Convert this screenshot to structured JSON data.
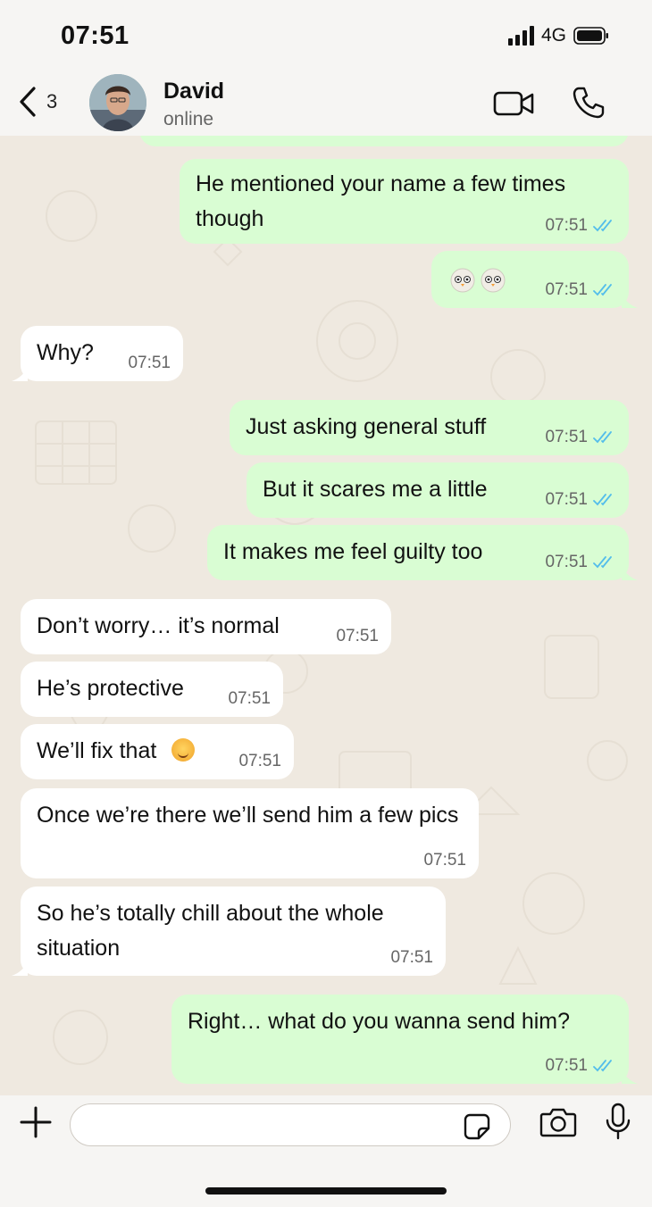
{
  "status_bar": {
    "time": "07:51",
    "network": "4G",
    "icons": [
      "signal-icon",
      "battery-icon"
    ]
  },
  "header": {
    "back_count": "3",
    "contact_name": "David",
    "contact_status": "online",
    "icons": [
      "chevron-left-icon",
      "video-camera-icon",
      "phone-icon"
    ]
  },
  "messages": [
    {
      "direction": "out",
      "text": "He mentioned your name a few times though",
      "time": "07:51",
      "status": "read"
    },
    {
      "direction": "out",
      "text": "",
      "stickers": 2,
      "time": "07:51",
      "status": "read"
    },
    {
      "direction": "in",
      "text": "Why?",
      "time": "07:51"
    },
    {
      "direction": "out",
      "text": "Just asking general stuff",
      "time": "07:51",
      "status": "read"
    },
    {
      "direction": "out",
      "text": "But it scares me a little",
      "time": "07:51",
      "status": "read"
    },
    {
      "direction": "out",
      "text": "It makes me feel guilty too",
      "time": "07:51",
      "status": "read"
    },
    {
      "direction": "in",
      "text": "Don’t worry… it’s normal",
      "time": "07:51"
    },
    {
      "direction": "in",
      "text": "He’s protective",
      "time": "07:51"
    },
    {
      "direction": "in",
      "text": "We’ll fix that",
      "emoji": "smiling-face",
      "time": "07:51"
    },
    {
      "direction": "in",
      "text": "Once we’re there we’ll send him a few pics",
      "time": "07:51"
    },
    {
      "direction": "in",
      "text": "So he’s totally chill about the whole situation",
      "time": "07:51"
    },
    {
      "direction": "out",
      "text": "Right… what do you wanna send him?",
      "time": "07:51",
      "status": "read"
    }
  ],
  "input_bar": {
    "input_value": "",
    "input_placeholder": "",
    "icons": [
      "plus-icon",
      "sticker-icon",
      "camera-icon",
      "microphone-icon"
    ]
  },
  "colors": {
    "outgoing_bubble": "#d9fdd3",
    "incoming_bubble": "#ffffff",
    "read_ticks": "#53bdeb",
    "chat_background": "#efe9e0"
  }
}
